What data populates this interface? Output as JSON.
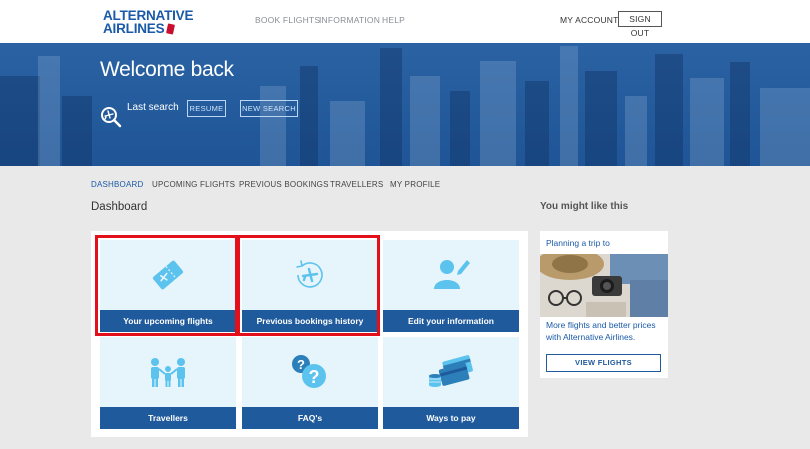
{
  "brand": {
    "line1": "ALTERNATIVE",
    "line2": "AIRLINES"
  },
  "topnav": {
    "book_flights": "BOOK FLIGHTS",
    "information": "INFORMATION",
    "help": "HELP",
    "my_account": "MY ACCOUNT",
    "sign_out": "SIGN OUT"
  },
  "hero": {
    "title": "Welcome back",
    "last_search": "Last search",
    "resume": "RESUME",
    "new_search": "NEW SEARCH"
  },
  "subnav": {
    "dashboard": "DASHBOARD",
    "upcoming": "UPCOMING FLIGHTS",
    "previous": "PREVIOUS BOOKINGS",
    "travellers": "TRAVELLERS",
    "profile": "MY PROFILE"
  },
  "dashboard": {
    "heading": "Dashboard",
    "tiles": [
      {
        "label": "Your upcoming flights",
        "icon": "ticket-icon"
      },
      {
        "label": "Previous bookings history",
        "icon": "plane-history-icon"
      },
      {
        "label": "Edit your information",
        "icon": "user-edit-icon"
      },
      {
        "label": "Travellers",
        "icon": "family-icon"
      },
      {
        "label": "FAQ's",
        "icon": "question-bubbles-icon"
      },
      {
        "label": "Ways to pay",
        "icon": "credit-cards-icon"
      }
    ]
  },
  "sidebar": {
    "heading": "You might like this",
    "promo_title": "Planning a trip to",
    "promo_text": "More flights and better prices with Alternative Airlines.",
    "promo_button": "VIEW FLIGHTS"
  },
  "colors": {
    "brand_blue": "#1a5aa8",
    "tile_bg": "#e6f4fb",
    "tile_label": "#1f5a9c",
    "highlight": "#e3101b",
    "icon_blue": "#5bc3ee"
  }
}
